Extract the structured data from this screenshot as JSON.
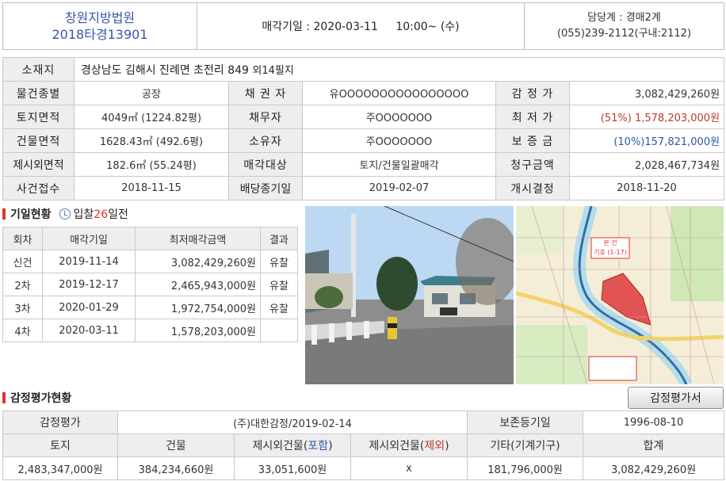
{
  "header": {
    "court": "창원지방법원",
    "case_no": "2018타경13901",
    "sale_date_label": "매각기일",
    "sale_date": "2020-03-11",
    "sale_time": "10:00~ (수)",
    "dept_label": "담당계",
    "dept": "경매2계",
    "phone": "(055)239-2112(구내:2112)"
  },
  "info": {
    "location_label": "소재지",
    "location": "경상남도 김해시 진례면 초전리 849",
    "location_extra": "외14필지",
    "rows": [
      [
        {
          "l": "물건종별",
          "v": "공장"
        },
        {
          "l": "채 권 자",
          "v": "유OOOOOOOOOOOOOOOO"
        },
        {
          "l": "감 정 가",
          "v": "3,082,429,260원"
        }
      ],
      [
        {
          "l": "토지면적",
          "v": "4049㎡ (1224.82평)"
        },
        {
          "l": "채무자",
          "v": "주OOOOOOO"
        },
        {
          "l": "최 저 가",
          "v": "(51%) 1,578,203,000원"
        }
      ],
      [
        {
          "l": "건물면적",
          "v": "1628.43㎡ (492.6평)"
        },
        {
          "l": "소유자",
          "v": "주OOOOOOO"
        },
        {
          "l": "보 증 금",
          "v": "(10%)157,821,000원"
        }
      ],
      [
        {
          "l": "제시외면적",
          "v": "182.6㎡ (55.24평)"
        },
        {
          "l": "매각대상",
          "v": "토지/건물일괄매각"
        },
        {
          "l": "청구금액",
          "v": "2,028,467,734원"
        }
      ],
      [
        {
          "l": "사건접수",
          "v": "2018-11-15"
        },
        {
          "l": "배당종기일",
          "v": "2019-02-07"
        },
        {
          "l": "개시결정",
          "v": "2018-11-20"
        }
      ]
    ]
  },
  "schedule": {
    "title": "기일현황",
    "dday_prefix": "입찰",
    "dday_num": "26",
    "dday_suffix": "일전",
    "headers": [
      "회차",
      "매각기일",
      "최저매각금액",
      "결과"
    ],
    "rows": [
      [
        "신건",
        "2019-11-14",
        "3,082,429,260원",
        "유찰"
      ],
      [
        "2차",
        "2019-12-17",
        "2,465,943,000원",
        "유찰"
      ],
      [
        "3차",
        "2020-01-29",
        "1,972,754,000원",
        "유찰"
      ],
      [
        "4차",
        "2020-03-11",
        "1,578,203,000원",
        ""
      ]
    ]
  },
  "map": {
    "label1": "본 건",
    "label2": "기호 (1-17)"
  },
  "appraisal": {
    "title": "감정평가현황",
    "button": "감정평가서",
    "row1": {
      "l1": "감정평가",
      "v1": "(주)대한감정/2019-02-14",
      "l2": "보존등기일",
      "v2": "1996-08-10"
    },
    "cols": [
      "토지",
      "건물",
      "제시외건물",
      "포함",
      "제시외건물",
      "제외",
      "기타(기계기구)",
      "합계"
    ],
    "values": [
      "2,483,347,000원",
      "384,234,660원",
      "33,051,600원",
      "x",
      "181,796,000원",
      "3,082,429,260원"
    ]
  }
}
